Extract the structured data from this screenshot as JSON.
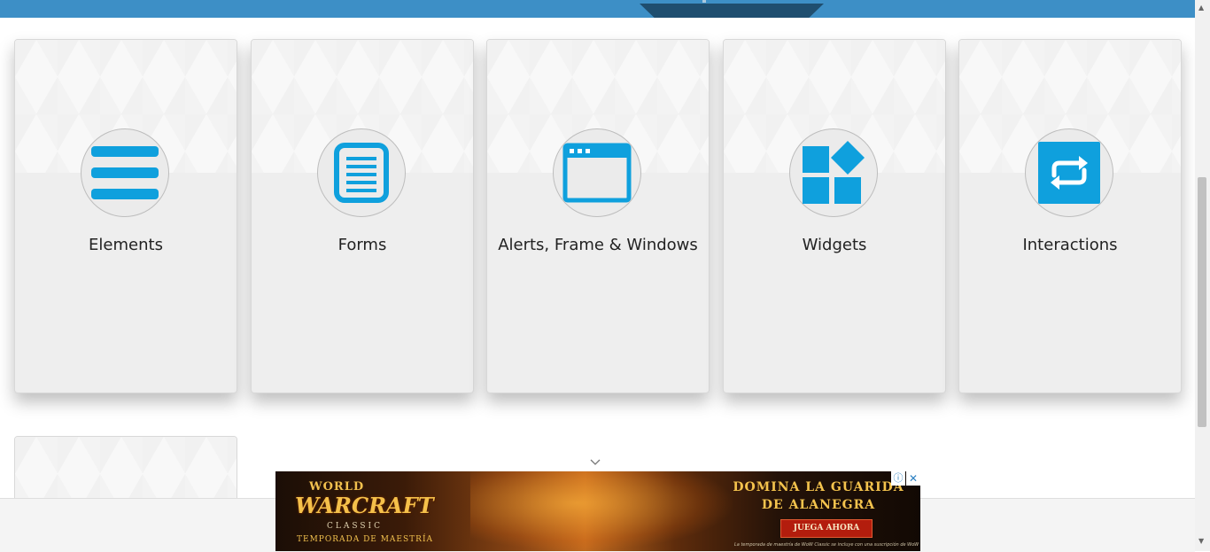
{
  "header": {
    "bar_color": "#3d8fc6",
    "tab_color": "#1f4e6f"
  },
  "icon_color": "#0fa0dd",
  "cards": [
    {
      "title": "Elements",
      "icon": "hamburger-menu-icon"
    },
    {
      "title": "Forms",
      "icon": "document-list-icon"
    },
    {
      "title": "Alerts, Frame & Windows",
      "icon": "browser-window-icon"
    },
    {
      "title": "Widgets",
      "icon": "widgets-blocks-icon"
    },
    {
      "title": "Interactions",
      "icon": "repeat-arrows-icon"
    }
  ],
  "ad": {
    "logo_line1": "WORLD",
    "logo_line2": "WARCRAFT",
    "logo_line3": "CLASSIC",
    "tagline": "TEMPORADA DE MAESTRÍA",
    "headline": "DOMINA LA GUARIDA DE ALANEGRA",
    "cta": "JUEGA AHORA",
    "fine_print": "La temporada de maestría de WoW Classic se incluye con una suscripción de WoW",
    "info_glyph": "ⓘ",
    "close_glyph": "✕"
  },
  "scrollbar": {
    "up_glyph": "▲",
    "down_glyph": "▼"
  }
}
